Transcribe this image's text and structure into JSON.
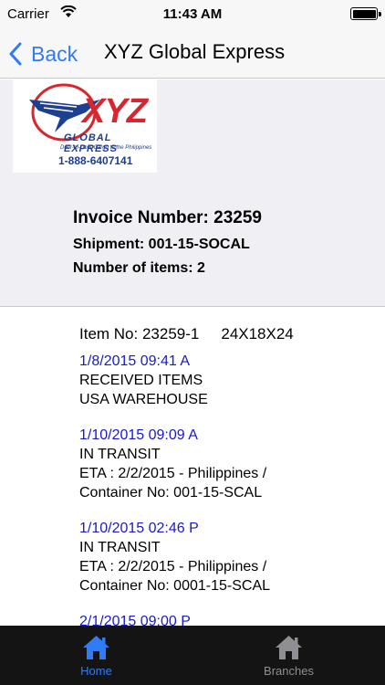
{
  "status_bar": {
    "carrier": "Carrier",
    "time": "11:43 AM"
  },
  "nav": {
    "back_label": "Back",
    "title": "XYZ Global Express"
  },
  "logo": {
    "brand": "XYZ",
    "subtitle": "GLOBAL EXPRESS",
    "tagline": "Door-to-Door Cargo to the Philippines",
    "phone": "1-888-6407141"
  },
  "invoice": {
    "number_label": "Invoice Number: 23259",
    "shipment_label": "Shipment: 001-15-SOCAL",
    "items_label": "Number of items: 2"
  },
  "item": {
    "number_label": "Item No: 23259-1",
    "dimensions": "24X18X24"
  },
  "events": [
    {
      "timestamp": "1/8/2015  09:41 A",
      "lines": [
        "RECEIVED ITEMS",
        "USA WAREHOUSE"
      ]
    },
    {
      "timestamp": "1/10/2015  09:09 A",
      "lines": [
        "IN TRANSIT",
        "ETA : 2/2/2015 - Philippines /",
        "Container No: 001-15-SCAL"
      ]
    },
    {
      "timestamp": "1/10/2015  02:46 P",
      "lines": [
        "IN TRANSIT",
        "ETA : 2/2/2015 - Philippines /",
        "Container No: 0001-15-SCAL"
      ]
    },
    {
      "timestamp": "2/1/2015  09:00 P",
      "lines": []
    }
  ],
  "tabs": {
    "home": "Home",
    "branches": "Branches"
  },
  "colors": {
    "accent": "#2f7cf6",
    "timestamp": "#1a1ac8",
    "tab_bar": "#141414",
    "logo_red": "#d7262e",
    "logo_blue": "#1d3f8f"
  }
}
